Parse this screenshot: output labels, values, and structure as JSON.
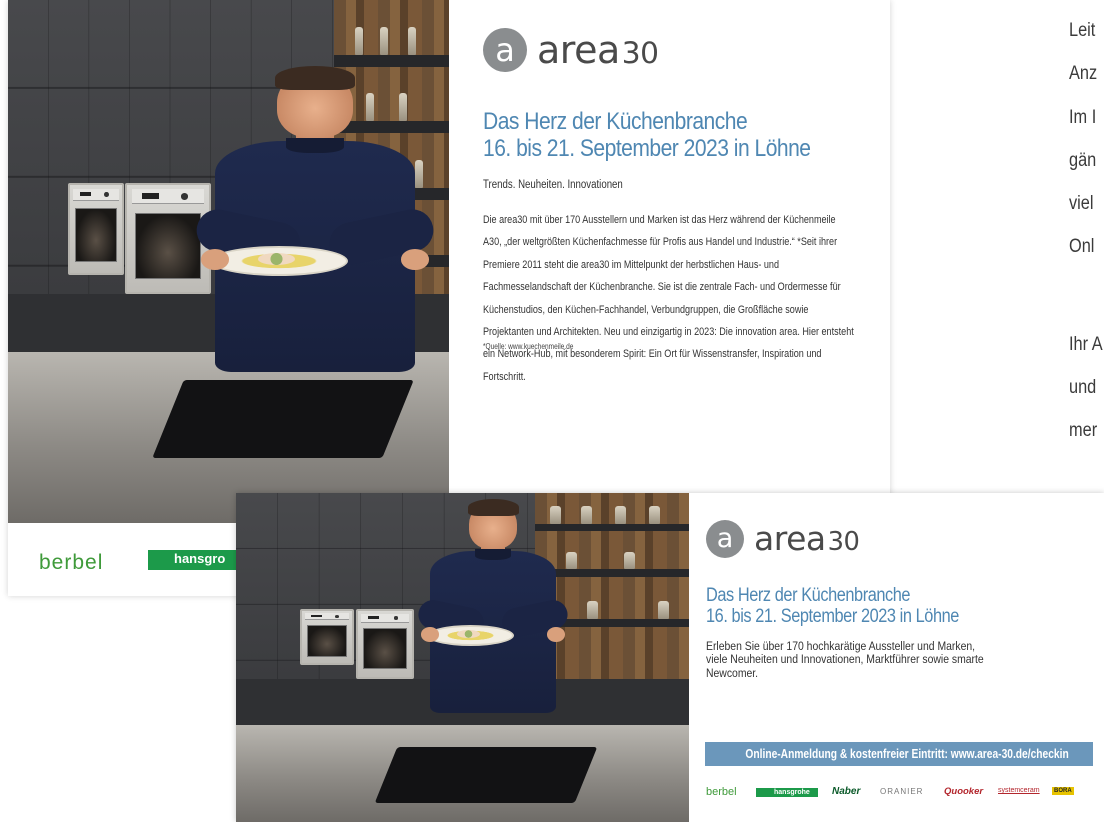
{
  "ad_large": {
    "logo": {
      "badge_letter": "a",
      "word": "area",
      "number": "30"
    },
    "headline_line1": "Das Herz der Küchenbranche",
    "headline_line2": "16. bis 21. September 2023 in Löhne",
    "subhead": "Trends. Neuheiten. Innovationen",
    "body": "Die area30 mit über 170 Ausstellern und Marken ist das Herz während der Küchenmeile A30, „der weltgrößten Küchenfachmesse für Profis aus Handel und Industrie.“ *Seit ihrer Premiere 2011 steht die area30 im Mittelpunkt der herbstlichen Haus- und Fachmesselandschaft der Küchenbranche. Sie ist die zentrale Fach- und Ordermesse für Küchenstudios, den Küchen-Fachhandel, Verbundgruppen, die Großfläche sowie Projektanten und Architekten. Neu und einzigartig in 2023: Die innovation area. Hier entsteht ein Network-Hub, mit besonderem Spirit: Ein Ort für Wissenstransfer, Inspiration und Fortschritt.",
    "source": "*Quelle: www.kuechenmeile.de",
    "sponsors": {
      "berbel": "berbel",
      "hansgrohe": "hansgro"
    }
  },
  "ad_small": {
    "logo": {
      "badge_letter": "a",
      "word": "area",
      "number": "30"
    },
    "headline_line1": "Das Herz der Küchenbranche",
    "headline_line2": "16. bis 21. September 2023 in Löhne",
    "intro": "Erleben Sie über 170 hochkarätige Aussteller und Marken, viele Neuheiten und Innovationen, Marktführer sowie smarte Newcomer.",
    "cta": "Online-Anmeldung & kostenfreier Eintritt: www.area-30.de/checkin",
    "sponsors": [
      "berbel",
      "hansgrohe",
      "Naber",
      "ORANIER",
      "Quooker",
      "systemceram",
      "BORA"
    ]
  },
  "sidetext": {
    "lines": [
      "Leit",
      "Anz",
      "Im I",
      "gän",
      "viel",
      "Onl",
      "Ihr A",
      "und",
      "mer"
    ]
  },
  "colors": {
    "headline": "#4f87b2",
    "cta": "#6b97bb",
    "logo_badge": "#8a8d8f"
  }
}
